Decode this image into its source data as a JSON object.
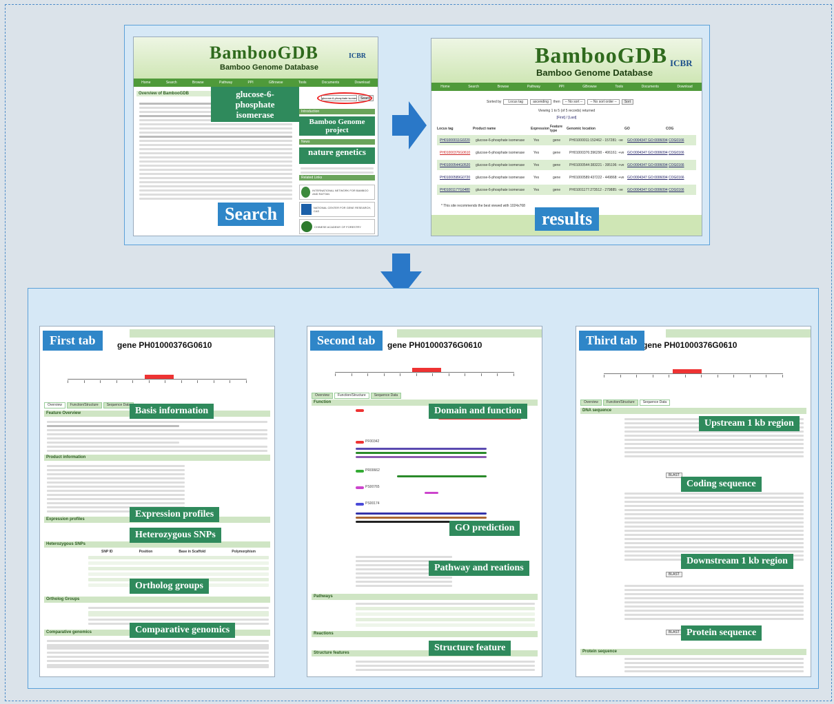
{
  "search_panel": {
    "logo": "BambooGDB",
    "subtitle": "Bamboo Genome Database",
    "icbr": "ICBR",
    "nav": [
      "Home",
      "Search",
      "Browse",
      "Pathway",
      "PPI",
      "GBrowse",
      "Tools",
      "Documents",
      "Download"
    ],
    "overview_title": "Overview of BambooGDB",
    "query_callout": "glucose-6-phosphate isomerase",
    "search_box_value": "glucose-6-phosphate isomerase",
    "search_button": "Search",
    "side_introduction": "Introduction",
    "side_project": "Bamboo Genome project",
    "side_news": "News",
    "side_nature": "nature genetics",
    "side_related": "Related Links",
    "links": [
      "INTERNATIONAL NETWORK FOR BAMBOO AND RATTAN",
      "NATIONAL CENTER FOR GENE RESEARCH, CAS",
      "CHINESE ACADEMY OF FORESTRY"
    ],
    "label": "Search"
  },
  "results_panel": {
    "logo": "BambooGDB",
    "subtitle": "Bamboo Genome Database",
    "icbr": "ICBR",
    "nav": [
      "Home",
      "Search",
      "Browse",
      "Pathway",
      "PPI",
      "GBrowse",
      "Tools",
      "Documents",
      "Download"
    ],
    "sort_label": "Sorted by",
    "sort_value": "Locus tag",
    "order_value": "ascending",
    "then_label": "then",
    "then_value1": "-- No sort --",
    "then_value2": "-- No sort order --",
    "sort_button": "Sort",
    "viewing": "Viewing 1 to 5 (of 5 records) returned",
    "first_last": "[First] / [Last]",
    "columns": [
      "Locus tag",
      "Product name",
      "Expression",
      "Feature type",
      "Genomic location",
      "GO",
      "COG"
    ],
    "rows": [
      {
        "locus": "PH01000011G0220",
        "product": "glucose-6-phosphate isomerase",
        "expr": "Yes",
        "ftype": "gene",
        "loc": "PH01000011:152462 - 157281: -ve",
        "go": "GO:0004347 GO:0006094",
        "cog": "COG0166"
      },
      {
        "locus": "PH01000376G0610",
        "product": "glucose-6-phosphate isomerase",
        "expr": "Yes",
        "ftype": "gene",
        "loc": "PH01000376:396290 - 406161: +ve",
        "go": "GO:0004347 GO:0006094",
        "cog": "COG0166"
      },
      {
        "locus": "PH01000544G0520",
        "product": "glucose-6-phosphate isomerase",
        "expr": "Yes",
        "ftype": "gene",
        "loc": "PH01000544:383221 - 395196: +ve",
        "go": "GO:0004347 GO:0006094",
        "cog": "COG0166"
      },
      {
        "locus": "PH01000589G0720",
        "product": "glucose-6-phosphate isomerase",
        "expr": "Yes",
        "ftype": "gene",
        "loc": "PH01000589:437222 - 449868: +ve",
        "go": "GO:0004347 GO:0006094",
        "cog": "COG0166"
      },
      {
        "locus": "PH01001177G0480",
        "product": "glucose-6-phosphate isomerase",
        "expr": "Yes",
        "ftype": "gene",
        "loc": "PH01001177:273512 - 279885: -ve",
        "go": "GO:0004347 GO:0006094",
        "cog": "COG0166"
      }
    ],
    "footnote": "* This site recommends the best viewed with 1024x768",
    "label": "results"
  },
  "first_tab": {
    "label": "First tab",
    "gene": "gene PH01000376G0610",
    "tabs": [
      "Overview",
      "Function/Structure",
      "Sequence Data"
    ],
    "sections": [
      "Feature Overview",
      "Product information",
      "Expression profiles",
      "Heterozygous SNPs",
      "Ortholog Groups",
      "Comparative genomics"
    ],
    "callouts": [
      "Basis information",
      "Expression profiles",
      "Heterozygous SNPs",
      "Ortholog groups",
      "Comparative genomics"
    ],
    "snp_columns": [
      "SNP ID",
      "Position",
      "Base in Scaffold",
      "Polymorphism"
    ]
  },
  "second_tab": {
    "label": "Second tab",
    "gene": "gene PH01000376G0610",
    "tabs": [
      "Overview",
      "Function/Structure",
      "Sequence Data"
    ],
    "sections": [
      "Function",
      "Pathways",
      "Reactions",
      "Structure features"
    ],
    "callouts": [
      "Domain and function",
      "GO prediction",
      "Pathway and reations",
      "Structure feature"
    ],
    "domains": [
      "PF00342",
      "PR00662",
      "PS00765",
      "PS00174"
    ]
  },
  "third_tab": {
    "label": "Third tab",
    "gene": "gene PH01000376G0610",
    "tabs": [
      "Overview",
      "Function/Structure",
      "Sequence Data"
    ],
    "sections": [
      "DNA sequence",
      "Protein sequence"
    ],
    "callouts": [
      "Upstream 1 kb region",
      "Coding sequence",
      "Downstream 1 kb region",
      "Protein sequence"
    ],
    "blast": "BLAST"
  },
  "colors": {
    "accent": "#2f86c8",
    "green": "#2f8a5c",
    "nav": "#4f9a3a",
    "arrow": "#2a78c8"
  }
}
